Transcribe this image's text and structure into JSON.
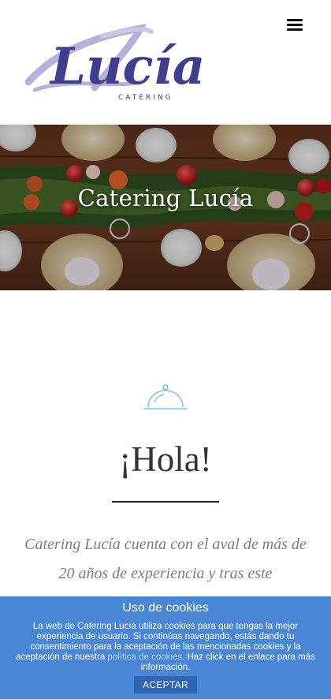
{
  "header": {
    "logo_script": "Lucía",
    "logo_subtitle": "CATERING",
    "menu_icon": "hamburger-menu-icon"
  },
  "hero": {
    "title": "Catering Lucía"
  },
  "intro": {
    "icon": "cloche-icon",
    "heading": "¡Hola!",
    "text": "Catering Lucía cuenta con el aval de más de 20 años de experiencia y tras este"
  },
  "cookie": {
    "title": "Uso de cookies",
    "text_before": "La web de Catering Lucía utiliza cookies para que tengas la mejor experiencia de usuario. Si continúas navegando, estás dando tu consentimiento para la aceptación de las mencionadas cookies y la aceptación de nuestra ",
    "link": "política de cookies",
    "text_after": ". Haz click en el enlace para más información.",
    "accept": "ACEPTAR"
  },
  "colors": {
    "logo_purple": "#3f3d8f",
    "logo_lavender": "#b4b2d8",
    "cookie_bar": "#4a86d6",
    "accept_button": "#2f64b1",
    "cloche": "#7fc4dc",
    "intro_text": "#7d7d7d"
  }
}
